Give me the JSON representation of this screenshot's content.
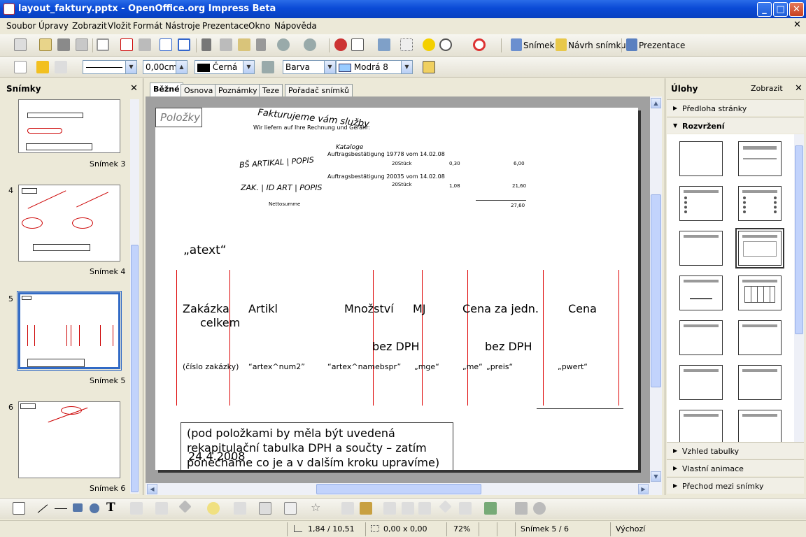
{
  "window": {
    "title": "layout_faktury.pptx - OpenOffice.org Impress Beta",
    "minimize": "_",
    "maximize": "□",
    "close": "✕"
  },
  "menu": [
    "Soubor",
    "Úpravy",
    "Zobrazit",
    "Vložit",
    "Formát",
    "Nástroje",
    "Prezentace",
    "Okno",
    "Nápověda"
  ],
  "doc_close": "✕",
  "toolbar1": {
    "snimek": "Snímek",
    "navrh": "Návrh snímku",
    "prezentace": "Prezentace"
  },
  "toolbar2": {
    "line_width": "0,00cm",
    "line_color": "Černá",
    "fill_type": "Barva",
    "fill_color": "Modrá 8"
  },
  "slides_panel": {
    "title": "Snímky",
    "close": "✕",
    "slides": [
      {
        "num": "",
        "label": "Snímek 3"
      },
      {
        "num": "4",
        "label": "Snímek 4"
      },
      {
        "num": "5",
        "label": "Snímek 5"
      },
      {
        "num": "6",
        "label": "Snímek 6"
      }
    ]
  },
  "tabs": [
    "Běžné",
    "Osnova",
    "Poznámky",
    "Teze",
    "Pořadač snímků"
  ],
  "slide": {
    "placeholder": "Položky",
    "scan_lines": {
      "heading": "Fakturujeme vám služby",
      "wir": "Wir liefern auf Ihre Rechnung und Gefahr:",
      "kataloge": "Kataloge",
      "ab1": "Auftragsbestätigung 19778 vom 14.02.08",
      "row1_qty": "20Stück",
      "row1_price": "0,30",
      "row1_total": "6,00",
      "hand1": "BŠ ARTIKAL | POPIS",
      "ab2": "Auftragsbestätigung 20035 vom 14.02.08",
      "row2_qty": "20Stück",
      "row2_price": "1,08",
      "row2_total": "21,60",
      "hand2": "ZAK. | ID ART | POPIS",
      "netto": "Nettosumme",
      "sum": "27,60"
    },
    "atext": "„atext“",
    "col_headers": {
      "zakazka": "Zakázka",
      "artikl": "Artikl",
      "mnozstvi": "Množství",
      "mj": "MJ",
      "cena_jedn": "Cena za jedn.",
      "cena": "Cena",
      "celkem": "celkem"
    },
    "bez_dph_1": "bez DPH",
    "bez_dph_2": "bez DPH",
    "fields": {
      "cislo": "(číslo zakázky)",
      "num2": "“artex^num2”",
      "namebspr": "“artex^namebspr”",
      "mge": "„mge“",
      "me": "„me“",
      "preis": "„preis“",
      "pwert": "„pwert“"
    },
    "note": "(pod položkami by měla být uvedená rekapitulační tabulka DPH a součty – zatím ponecháme co je a v dalším kroku upravíme)",
    "date": "24.4.2008"
  },
  "tasks": {
    "title": "Úlohy",
    "view": "Zobrazit",
    "close": "✕",
    "sections_top": [
      "Předloha stránky",
      "Rozvržení"
    ],
    "sections_bottom": [
      "Vzhled tabulky",
      "Vlastní animace",
      "Přechod mezi snímky"
    ]
  },
  "status": {
    "pos": "1,84 / 10,51",
    "size": "0,00 x 0,00",
    "zoom": "72%",
    "slide": "Snímek 5 / 6",
    "layout": "Výchozí"
  },
  "colors": {
    "title_blue": "#0a4ad6",
    "red_line": "#dd0000",
    "black_swatch": "#000000",
    "blue_swatch": "#99ccff"
  }
}
